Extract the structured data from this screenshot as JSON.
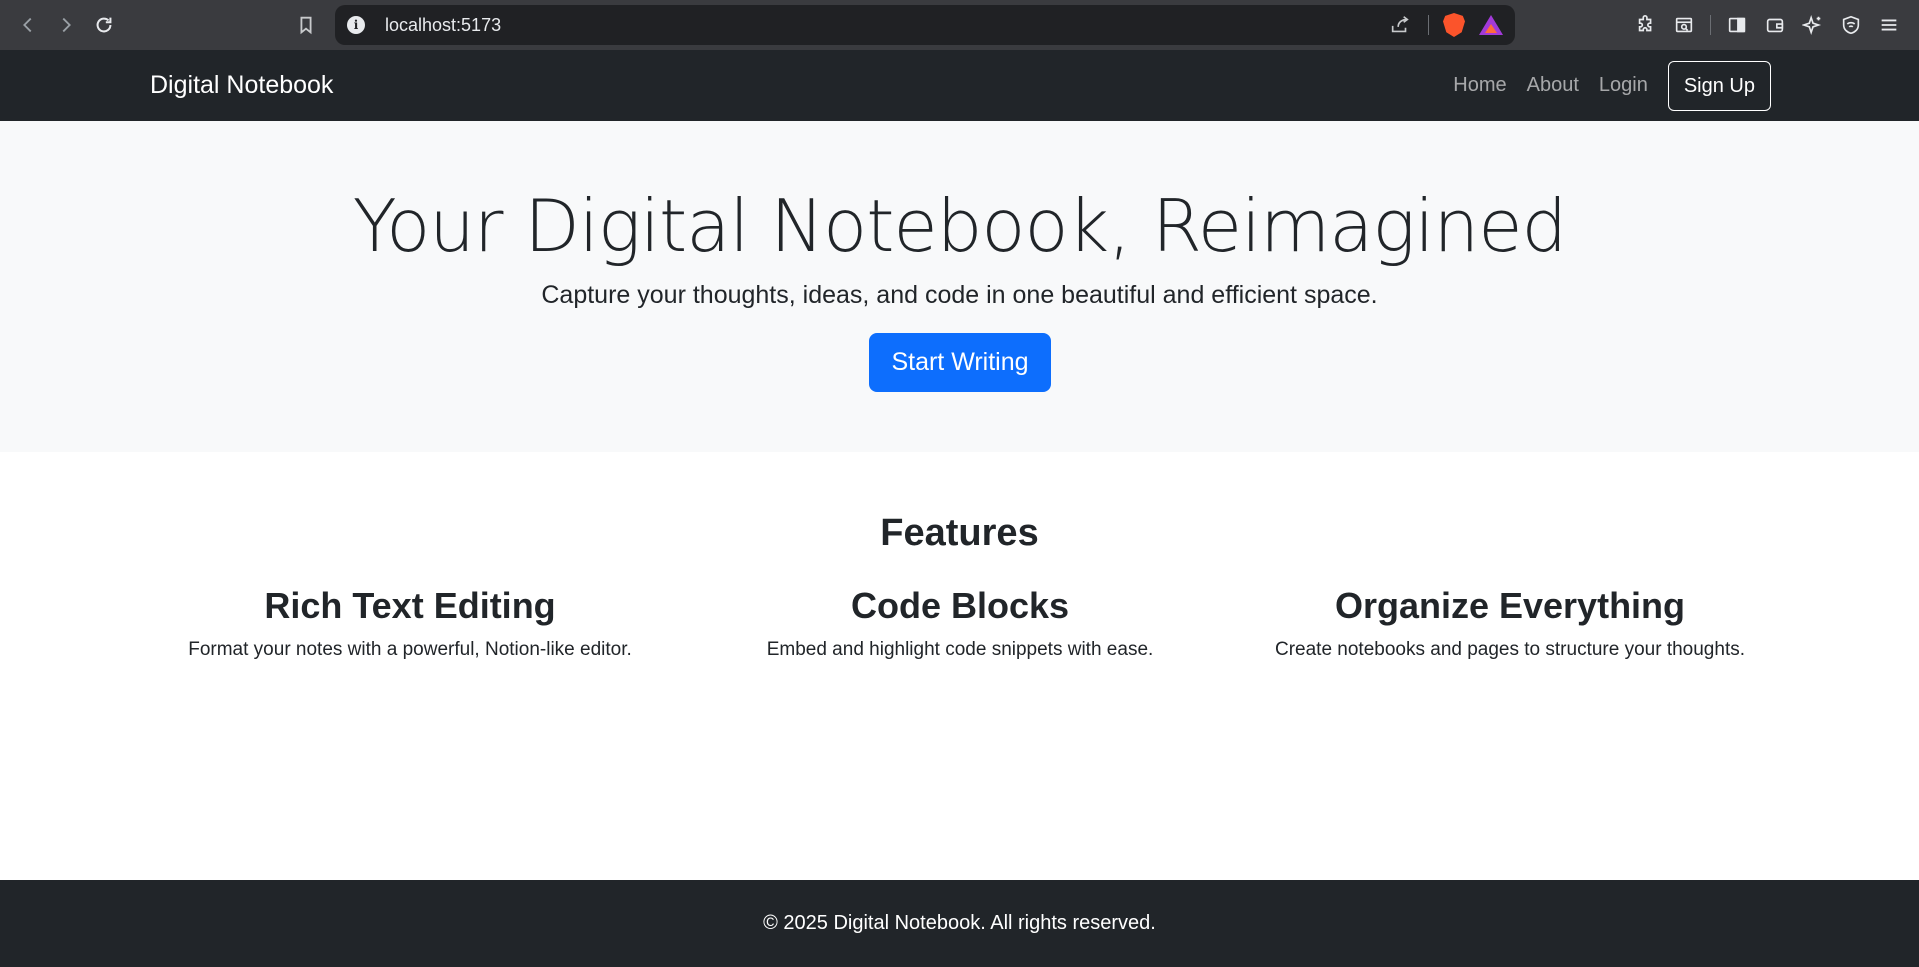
{
  "browser": {
    "url": "localhost:5173",
    "icons": [
      "back-icon",
      "forward-icon",
      "reload-icon",
      "bookmark-icon",
      "info-icon",
      "share-icon",
      "brave-shields-icon",
      "brave-rewards-icon",
      "extensions-icon",
      "search-tabs-icon",
      "sidebar-icon",
      "wallet-icon",
      "leo-ai-icon",
      "vpn-icon",
      "menu-icon"
    ]
  },
  "navbar": {
    "brand": "Digital Notebook",
    "links": [
      "Home",
      "About",
      "Login"
    ],
    "signup_label": "Sign Up"
  },
  "hero": {
    "title": "Your Digital Notebook, Reimagined",
    "subtitle": "Capture your thoughts, ideas, and code in one beautiful and efficient space.",
    "cta_label": "Start Writing",
    "cta_color": "#0d6efd"
  },
  "features": {
    "heading": "Features",
    "items": [
      {
        "title": "Rich Text Editing",
        "description": "Format your notes with a powerful, Notion-like editor."
      },
      {
        "title": "Code Blocks",
        "description": "Embed and highlight code snippets with ease."
      },
      {
        "title": "Organize Everything",
        "description": "Create notebooks and pages to structure your thoughts."
      }
    ]
  },
  "footer": {
    "text": "© 2025 Digital Notebook. All rights reserved."
  },
  "colors": {
    "navbar_bg": "#212529",
    "hero_bg": "#f8f9fa",
    "primary": "#0d6efd"
  }
}
